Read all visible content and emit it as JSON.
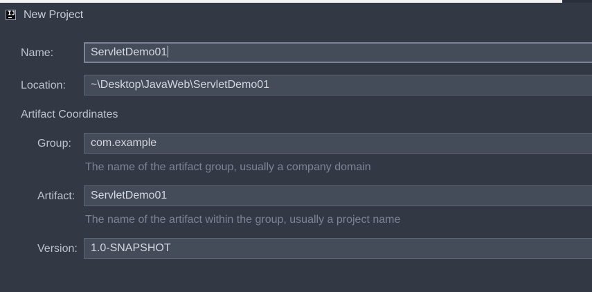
{
  "window": {
    "title": "New Project",
    "icon": "intellij-idea-icon",
    "icon_glyph": "IJ"
  },
  "form": {
    "name_label": "Name:",
    "name_value": "ServletDemo01",
    "location_label": "Location:",
    "location_value": "~\\Desktop\\JavaWeb\\ServletDemo01",
    "section_title": "Artifact Coordinates",
    "group_label": "Group:",
    "group_value": "com.example",
    "group_hint": "The name of the artifact group, usually a company domain",
    "artifact_label": "Artifact:",
    "artifact_value": "ServletDemo01",
    "artifact_hint": "The name of the artifact within the group, usually a project name",
    "version_label": "Version:",
    "version_value": "1.0-SNAPSHOT"
  },
  "colors": {
    "background": "#323844",
    "field_background": "#454c59",
    "field_border": "#5d6573",
    "label_text": "#bcc3ce",
    "hint_text": "#7d8594"
  }
}
